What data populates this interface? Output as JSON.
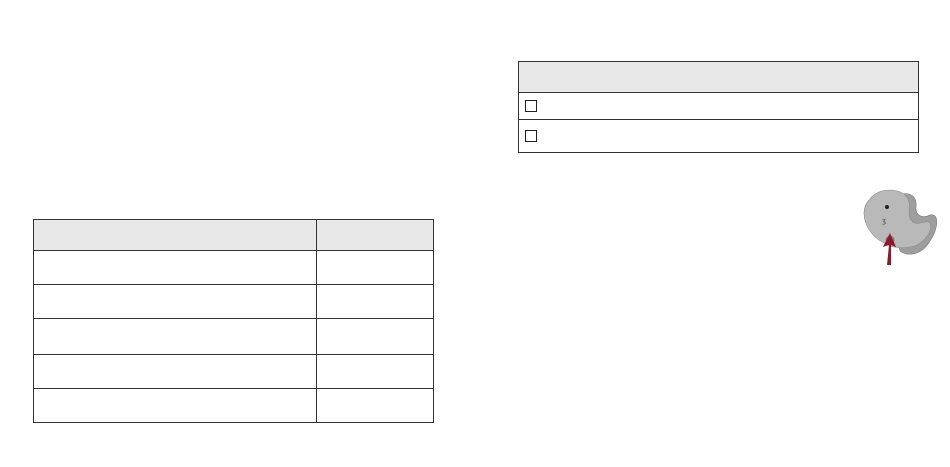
{
  "left_table": {
    "header": [
      "",
      ""
    ],
    "rows": [
      [
        "",
        ""
      ],
      [
        "",
        ""
      ],
      [
        "",
        ""
      ],
      [
        "",
        ""
      ],
      [
        "",
        ""
      ]
    ]
  },
  "right_table": {
    "header": "",
    "options": [
      "",
      ""
    ]
  },
  "figure": {
    "icon": "ear-insertion-diagram-icon",
    "arrow_color": "#8b1a2b",
    "shape_color": "#b5b5b5"
  }
}
